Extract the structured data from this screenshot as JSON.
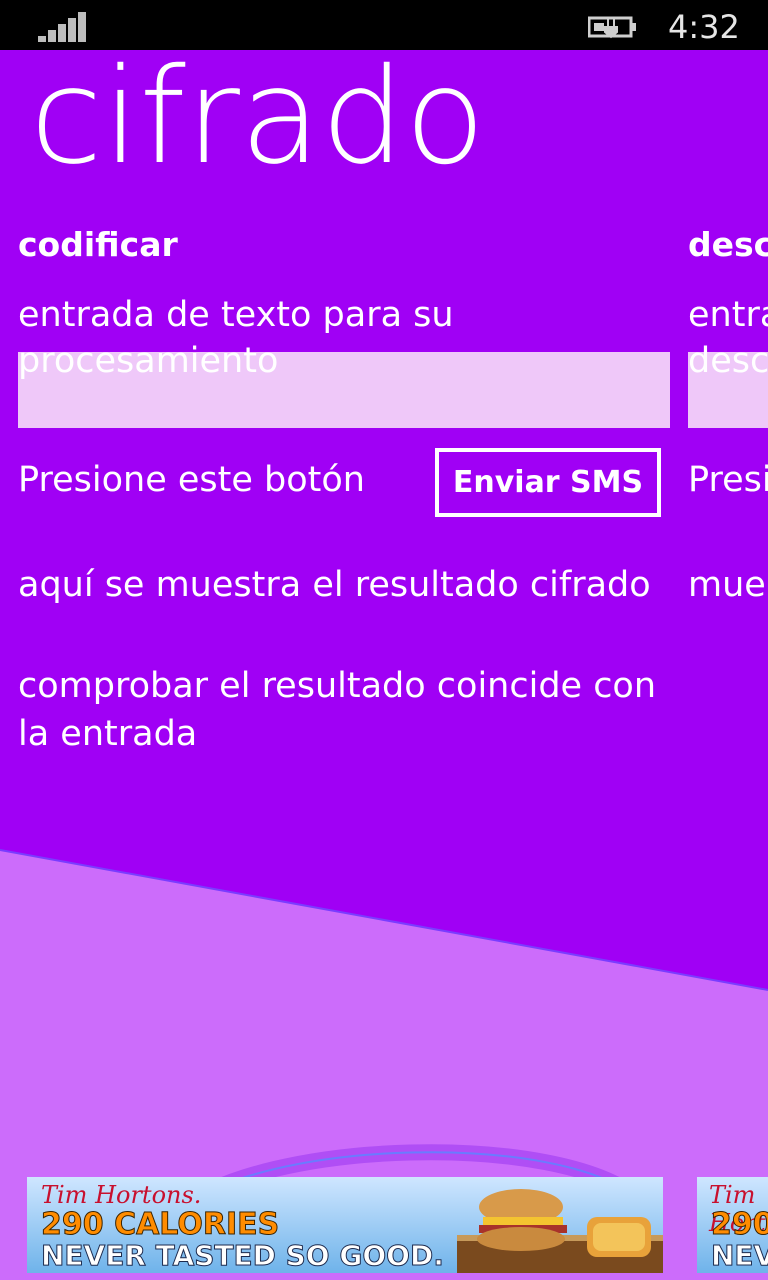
{
  "status_bar": {
    "time": "4:32",
    "signal_icon": "signal-bars-icon",
    "battery_icon": "battery-charging-icon"
  },
  "app": {
    "title": "cifrado"
  },
  "panes": [
    {
      "header": "codificar",
      "input_prompt": "entrada de texto para su procesamiento",
      "press_label": "Presione este botón",
      "button_label": "Enviar SMS",
      "result_label": "aquí se muestra el resultado cifrado",
      "check_label": "comprobar el resultado coincide con la entrada"
    },
    {
      "header": "desco",
      "input_prompt_line1": "entra",
      "input_prompt_line2": "desc",
      "press_label": "Presi",
      "result_label": "mue"
    }
  ],
  "ad": {
    "brand": "Tim Hortons.",
    "headline": "290 CALORIES",
    "tagline": "NEVER TASTED SO GOOD.",
    "partial_brand": "Tim Hortons.",
    "partial_headline": "290",
    "partial_tagline": "NEV"
  },
  "colors": {
    "accent": "#a000f5",
    "accent_light": "#cc6cfb",
    "input_bg": "#efc8f9"
  }
}
